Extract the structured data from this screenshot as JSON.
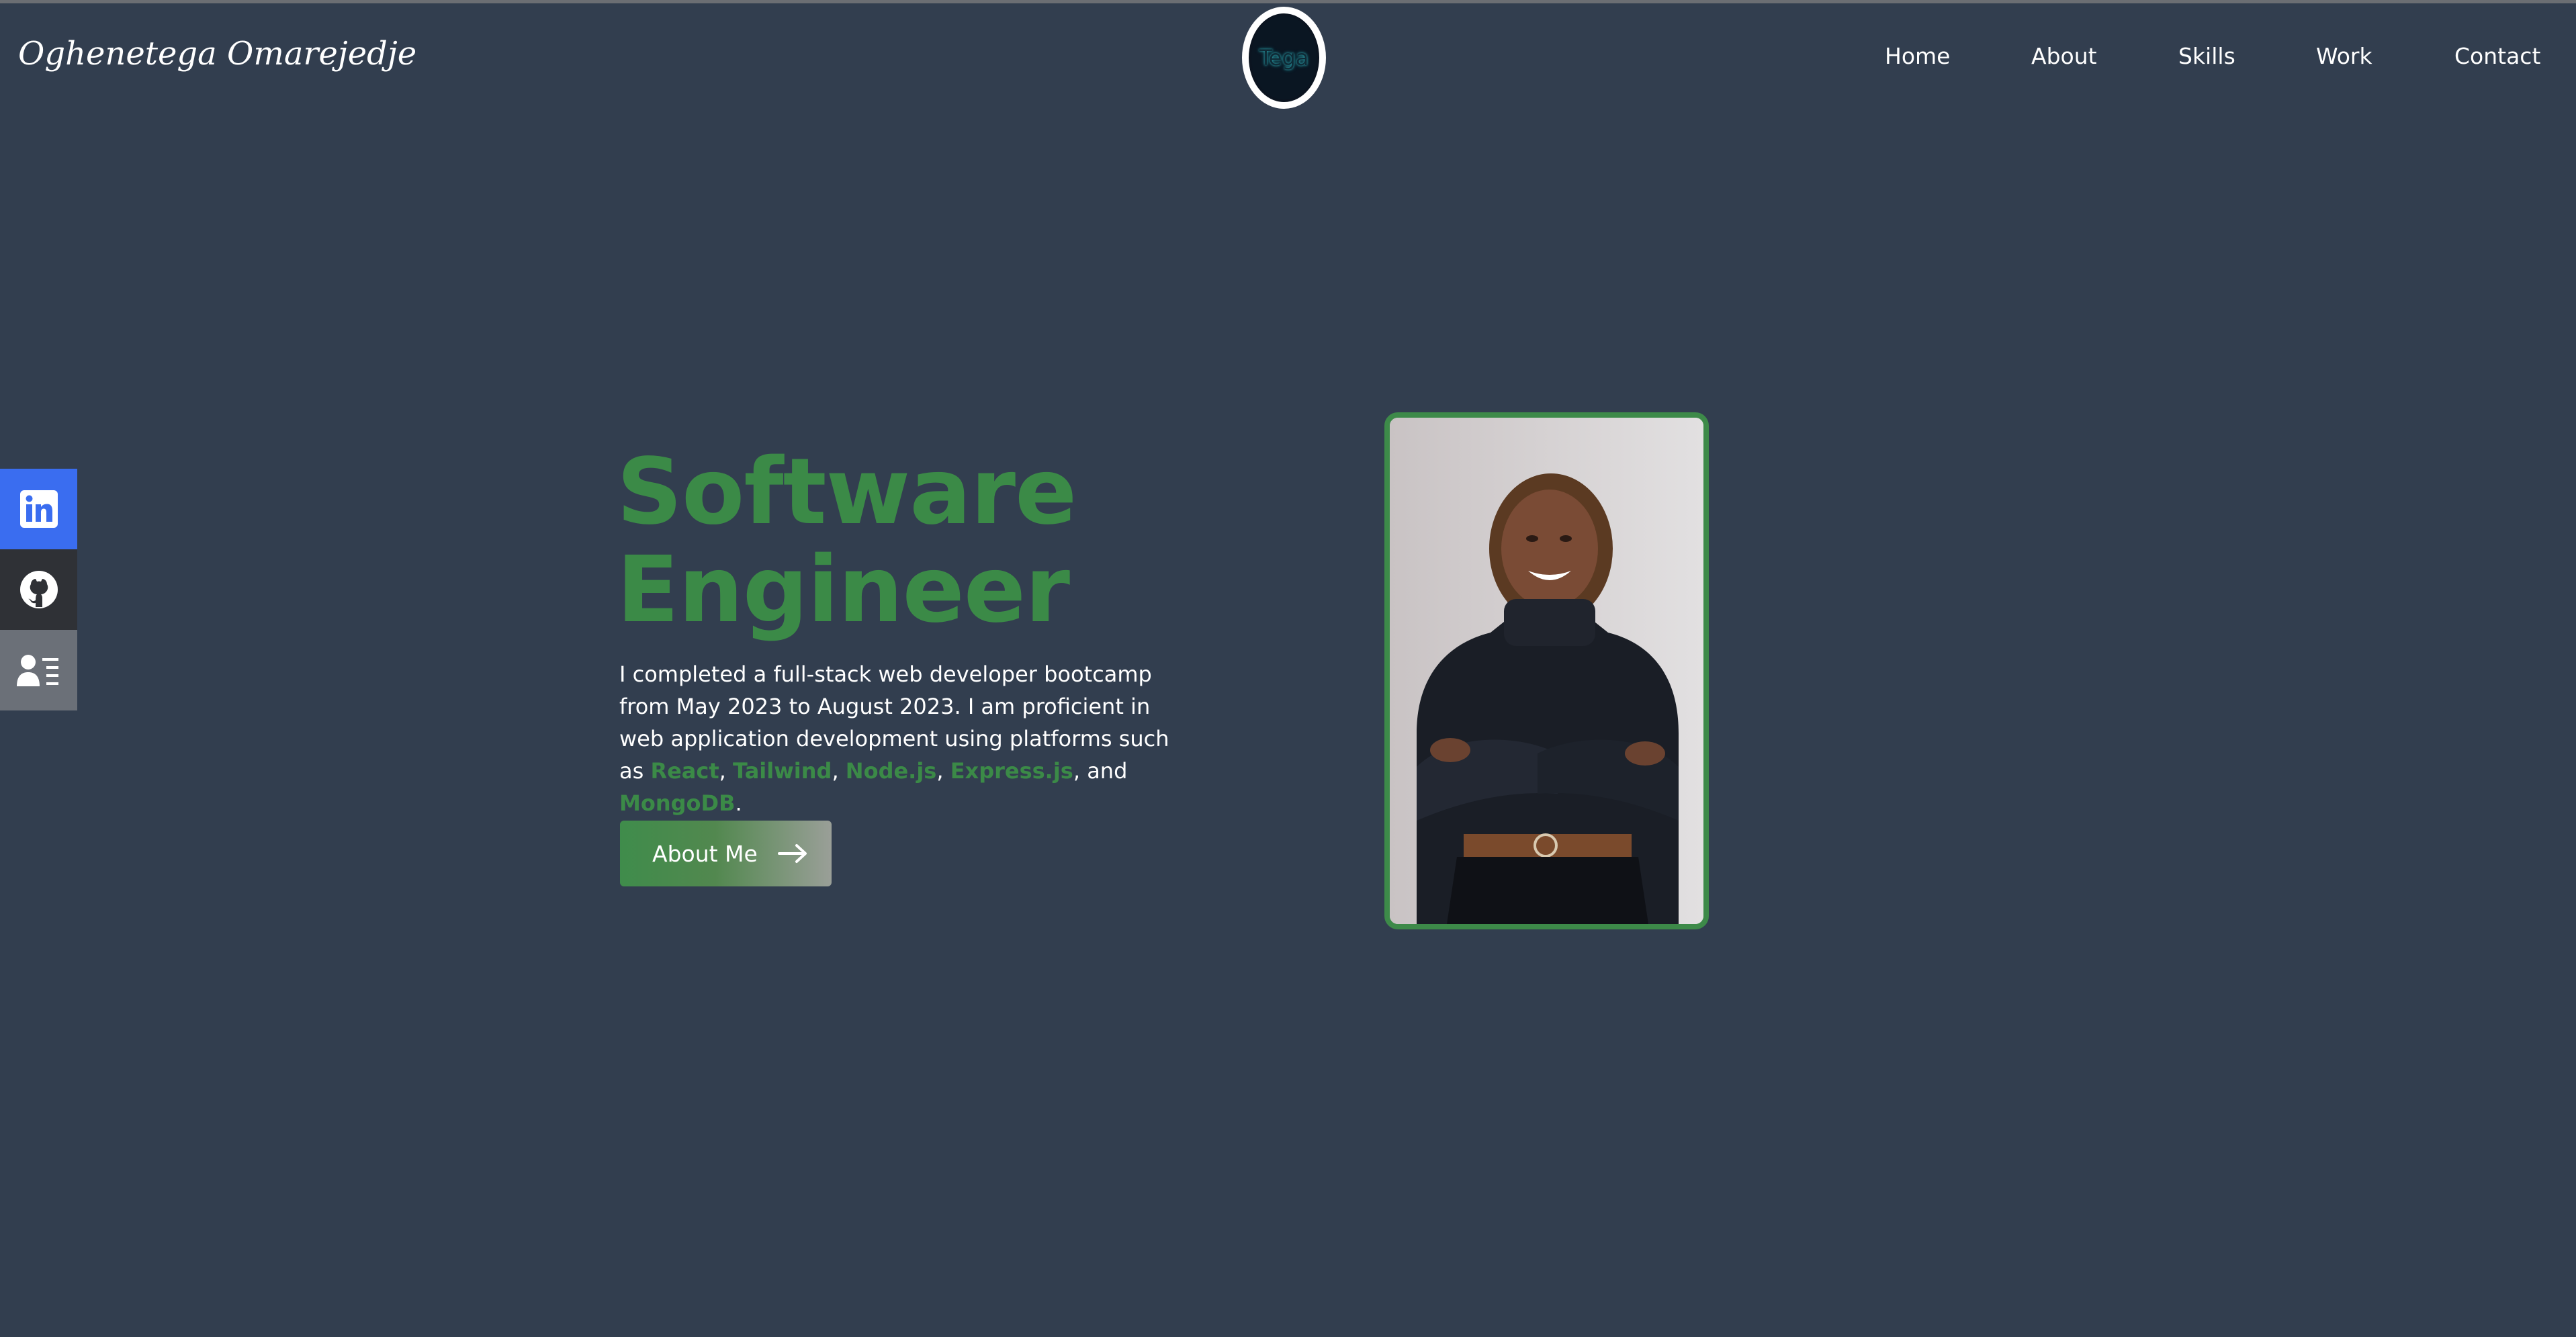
{
  "header": {
    "brand_name": "Oghenetega Omarejedje",
    "logo_text": "Tega",
    "nav": [
      {
        "label": "Home"
      },
      {
        "label": "About"
      },
      {
        "label": "Skills"
      },
      {
        "label": "Work"
      },
      {
        "label": "Contact"
      }
    ]
  },
  "social": [
    {
      "icon": "linkedin-icon",
      "color": "#3a6df0"
    },
    {
      "icon": "github-icon",
      "color": "#2f3136"
    },
    {
      "icon": "resume-icon",
      "color": "#6b7078"
    }
  ],
  "hero": {
    "title_line1": "Software",
    "title_line2": "Engineer",
    "description_part1": "I completed a full-stack web developer bootcamp from May 2023 to August 2023. I am proficient in web application development using platforms such as ",
    "technologies": [
      "React",
      "Tailwind",
      "Node.js",
      "Express.js",
      "MongoDB"
    ],
    "separator": ", ",
    "conjunction": ", and ",
    "period": ".",
    "button_label": "About Me",
    "button_icon": "arrow-right-icon"
  },
  "colors": {
    "background": "#323e4f",
    "accent_green": "#3b8a47",
    "text": "#ffffff"
  }
}
